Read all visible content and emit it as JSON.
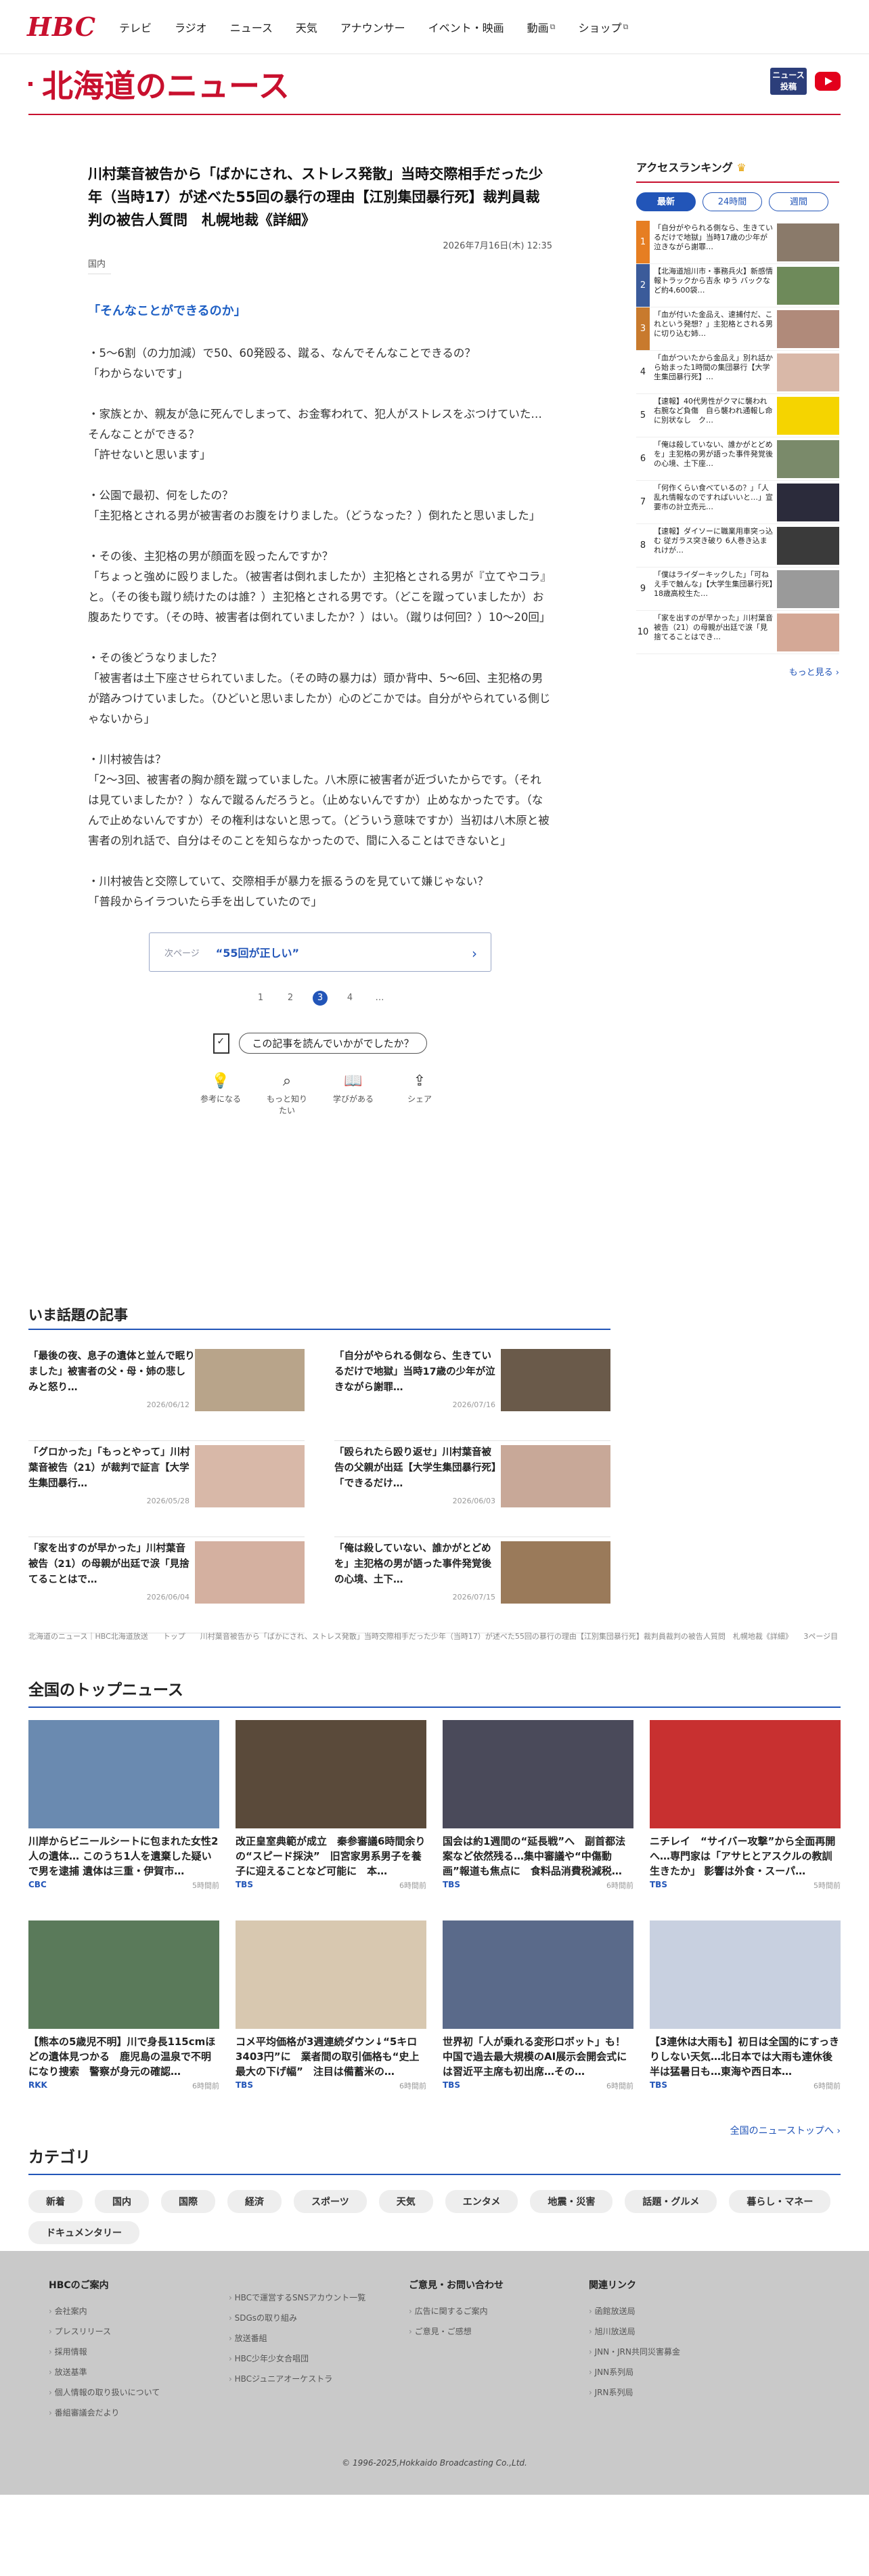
{
  "header": {
    "logo": "HBC",
    "nav": [
      {
        "label": "テレビ",
        "ext": false
      },
      {
        "label": "ラジオ",
        "ext": false
      },
      {
        "label": "ニュース",
        "ext": false
      },
      {
        "label": "天気",
        "ext": false
      },
      {
        "label": "アナウンサー",
        "ext": false
      },
      {
        "label": "イベント・映画",
        "ext": false
      },
      {
        "label": "動画",
        "ext": true
      },
      {
        "label": "ショップ",
        "ext": true
      }
    ]
  },
  "section": {
    "title": "北海道のニュース",
    "news_btn": "ニュース投稿"
  },
  "article": {
    "title": "川村葉音被告から「ばかにされ、ストレス発散」当時交際相手だった少年（当時17）が述べた55回の暴行の理由【江別集団暴行死】裁判員裁判の被告人質問　札幌地裁《詳細》",
    "date": "2026年7月16日(木) 12:35",
    "category": "国内",
    "subhead": "「そんなことができるのか」",
    "paragraphs": [
      "・5～6割（の力加減）で50、60発殴る、蹴る、なんでそんなことできるの？\n「わからないです」",
      "・家族とか、親友が急に死んでしまって、お金奪われて、犯人がストレスをぶつけていた…そんなことができる？\n「許せないと思います」",
      "・公園で最初、何をしたの？\n「主犯格とされる男が被害者のお腹をけりました。（どうなった？）倒れたと思いました」",
      "・その後、主犯格の男が顔面を殴ったんですか？\n「ちょっと強めに殴りました。（被害者は倒れましたか）主犯格とされる男が『立てやコラ』と。（その後も蹴り続けたのは誰？）主犯格とされる男です。（どこを蹴っていましたか）お腹あたりです。（その時、被害者は倒れていましたか？）はい。（蹴りは何回？）10～20回」",
      "・その後どうなりました？\n「被害者は土下座させられていました。（その時の暴力は）頭か背中、5～6回、主犯格の男が踏みつけていました。（ひどいと思いましたか）心のどこかでは。自分がやられている側じゃないから」",
      "・川村被告は？\n「2～3回、被害者の胸か顔を蹴っていました。八木原に被害者が近づいたからです。（それは見ていましたか？）なんで蹴るんだろうと。（止めないんですか）止めなかったです。（なんで止めないんですか）その権利はないと思って。（どういう意味ですか）当初は八木原と被害者の別れ話で、自分はそのことを知らなかったので、間に入ることはできないと」",
      "・川村被告と交際していて、交際相手が暴力を振るうのを見ていて嫌じゃない？\n「普段からイラついたら手を出していたので」"
    ],
    "next_label": "次ページ",
    "next_title": "“55回が正しい”",
    "pages": [
      "1",
      "2",
      "3",
      "4",
      "…"
    ],
    "current_page": "3",
    "feedback_q": "この記事を読んでいかがでしたか？",
    "reactions": [
      "参考になる",
      "もっと知りたい",
      "学びがある",
      "シェア"
    ]
  },
  "ranking": {
    "title": "アクセスランキング",
    "tabs": [
      "最新",
      "24時間",
      "週間"
    ],
    "items": [
      {
        "num": "1",
        "text": "「自分がやられる側なら、生きているだけで地獄」当時17歳の少年が泣きながら謝罪…"
      },
      {
        "num": "2",
        "text": "【北海道旭川市・事務兵火】新感情報トラックから吉永 ゆう バックなど約4,600袋…"
      },
      {
        "num": "3",
        "text": "「血が付いた金品え、速捕付だ、これという発想？」主犯格とされる男に切り込む姉…"
      },
      {
        "num": "4",
        "text": "「血がついたから金品え」別れ話から始まった1時間の集団暴行【大学生集団暴行死】…"
      },
      {
        "num": "5",
        "text": "【速報】40代男性がクマに襲われ右腕など負傷　自ら襲われ通報し命に別状なし　ク…"
      },
      {
        "num": "6",
        "text": "「俺は殺していない、誰かがとどめを」主犯格の男が語った事件発覚後の心境、土下座…"
      },
      {
        "num": "7",
        "text": "「何作くらい食べているの？」「人乱れ情報なのですればいいと…」宣要市の計立売元…"
      },
      {
        "num": "8",
        "text": "【速報】ダイソーに職業用車突っ込む 従ガラス突き破り 6人巻き込まれけが…"
      },
      {
        "num": "9",
        "text": "「僕はライダーキックした」「可ねえ手で触んな」【大学生集団暴行死】18歳高校生た…"
      },
      {
        "num": "10",
        "text": "「家を出すのが早かった」川村葉音被告（21）の母親が出廷で涙「見捨てることはでき…"
      }
    ],
    "more": "もっと見る"
  },
  "popular": {
    "title": "いま話題の記事",
    "items": [
      {
        "text": "「最後の夜、息子の遺体と並んで眠りました」被害者の父・母・姉の悲しみと怒り…",
        "date": "2026/06/12"
      },
      {
        "text": "「自分がやられる側なら、生きているだけで地獄」当時17歳の少年が泣きながら謝罪…",
        "date": "2026/07/16"
      },
      {
        "text": "「グロかった」「もっとやって」川村葉音被告（21）が裁判で証言【大学生集団暴行…",
        "date": "2026/05/28"
      },
      {
        "text": "「殴られたら殴り返せ」川村葉音被告の父親が出廷【大学生集団暴行死】「できるだけ…",
        "date": "2026/06/03"
      },
      {
        "text": "「家を出すのが早かった」川村葉音被告（21）の母親が出廷で涙「見捨てることはで…",
        "date": "2026/06/04"
      },
      {
        "text": "「俺は殺していない、誰かがとどめを」主犯格の男が語った事件発覚後の心境、土下…",
        "date": "2026/07/15"
      }
    ]
  },
  "breadcrumb": "北海道のニュース｜HBC北海道放送　　トップ　　川村葉音被告から「ばかにされ、ストレス発散」当時交際相手だった少年（当時17）が述べた55回の暴行の理由【江別集団暴行死】裁判員裁判の被告人質問　札幌地裁《詳細》　　3ページ目",
  "national": {
    "title": "全国のトップニュース",
    "items": [
      {
        "text": "川岸からビニールシートに包まれた女性2人の遺体… このうち1人を遺棄した疑いで男を逮捕 遺体は三重・伊賀市…",
        "src": "CBC",
        "time": "5時間前"
      },
      {
        "text": "改正皇室典範が成立　秦参審議6時間余りの“スピード採決”　旧宮家男系男子を養子に迎えることなど可能に　本…",
        "src": "TBS",
        "time": "6時間前"
      },
      {
        "text": "国会は約1週間の“延長戦”へ　副首都法案など依然残る…集中審議や“中傷動画”報道も焦点に　食料品消費税減税…",
        "src": "TBS",
        "time": "6時間前"
      },
      {
        "text": "ニチレイ　“サイバー攻撃”から全面再開へ…専門家は「アサヒとアスクルの教訓生きたか」 影響は外食・スーパ…",
        "src": "TBS",
        "time": "5時間前"
      },
      {
        "text": "【熊本の5歳児不明】川で身長115cmほどの遺体見つかる　鹿児島の温泉で不明になり捜索　警察が身元の確認…",
        "src": "RKK",
        "time": "6時間前"
      },
      {
        "text": "コメ平均価格が3週連続ダウン↓“5キロ3403円”に　業者間の取引価格も“史上最大の下げ幅”　注目は備蓄米の…",
        "src": "TBS",
        "time": "6時間前"
      },
      {
        "text": "世界初「人が乗れる変形ロボット」も！中国で過去最大規模のAI展示会開会式には習近平主席も初出席…その…",
        "src": "TBS",
        "time": "6時間前"
      },
      {
        "text": "【3連休は大雨も】初日は全国的にすっきりしない天気…北日本では大雨も連休後半は猛暑日も…東海や西日本…",
        "src": "TBS",
        "time": "6時間前"
      }
    ],
    "more": "全国のニューストップへ"
  },
  "categories": {
    "title": "カテゴリ",
    "items": [
      "新着",
      "国内",
      "国際",
      "経済",
      "スポーツ",
      "天気",
      "エンタメ",
      "地震・災害",
      "話題・グルメ",
      "暮らし・マネー",
      "ドキュメンタリー"
    ]
  },
  "footer": {
    "cols": [
      {
        "title": "HBCのご案内",
        "items": [
          "会社案内",
          "プレスリリース",
          "採用情報",
          "放送基準",
          "個人情報の取り扱いについて",
          "番組審議会だより"
        ]
      },
      {
        "title": "",
        "items": [
          "HBCで運営するSNSアカウント一覧",
          "SDGsの取り組み",
          "放送番組",
          "HBC少年少女合唱団",
          "HBCジュニアオーケストラ"
        ]
      },
      {
        "title": "ご意見・お問い合わせ",
        "items": [
          "広告に関するご案内",
          "ご意見・ご感想"
        ]
      },
      {
        "title": "関連リンク",
        "items": [
          "函館放送局",
          "旭川放送局",
          "JNN・JRN共同災害募金",
          "JNN系列局",
          "JRN系列局"
        ]
      }
    ],
    "copyright": "© 1996-2025,Hokkaido Broadcasting Co.,Ltd."
  }
}
